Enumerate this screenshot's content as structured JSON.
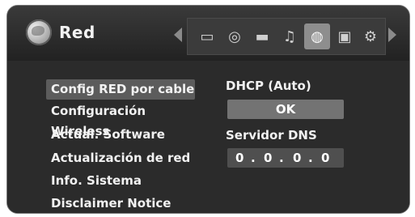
{
  "header": {
    "title": "Red",
    "icons": [
      "tv-icon",
      "disc-icon",
      "display-icon",
      "audio-icon",
      "network-icon",
      "lock-icon",
      "gear-icon"
    ],
    "selected_icon": "network-icon"
  },
  "menu": {
    "items": [
      {
        "label": "Config RED por cable"
      },
      {
        "label": "Configuración Wireless"
      },
      {
        "label": "Actual. Software"
      },
      {
        "label": "Actualización de red"
      },
      {
        "label": "Info. Sistema"
      },
      {
        "label": "Disclaimer Notice"
      }
    ]
  },
  "details": {
    "dhcp_label": "DHCP (Auto)",
    "ok_label": "OK",
    "dns_label": "Servidor DNS",
    "dns_octets": [
      "0",
      "0",
      "0",
      "0"
    ],
    "dns_sep": "."
  },
  "colors": {
    "background": "#2b2b2b",
    "header": "#222222",
    "selected_menu": "#5c5c5c",
    "ok_button": "#737373",
    "text": "#f1f1f1"
  }
}
